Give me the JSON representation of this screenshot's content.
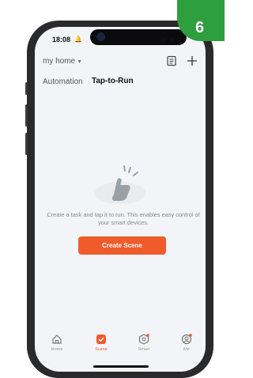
{
  "status_bar": {
    "time": "18:08"
  },
  "badge": {
    "digit": "6"
  },
  "header": {
    "home_selector": "my home"
  },
  "tabs": {
    "automation": "Automation",
    "tap_to_run": "Tap-to-Run"
  },
  "empty_state": {
    "message": "Create a task and tap it to run. This enables easy control of your smart devices.",
    "button": "Create Scene"
  },
  "tabbar": [
    {
      "label": "Home",
      "icon": "home-icon",
      "active": false
    },
    {
      "label": "Scene",
      "icon": "scene-icon",
      "active": true
    },
    {
      "label": "Smart",
      "icon": "smart-icon",
      "active": false
    },
    {
      "label": "Me",
      "icon": "profile-icon",
      "active": false
    }
  ],
  "colors": {
    "accent": "#ef5b2a",
    "green_badge": "#2e9e3f"
  }
}
